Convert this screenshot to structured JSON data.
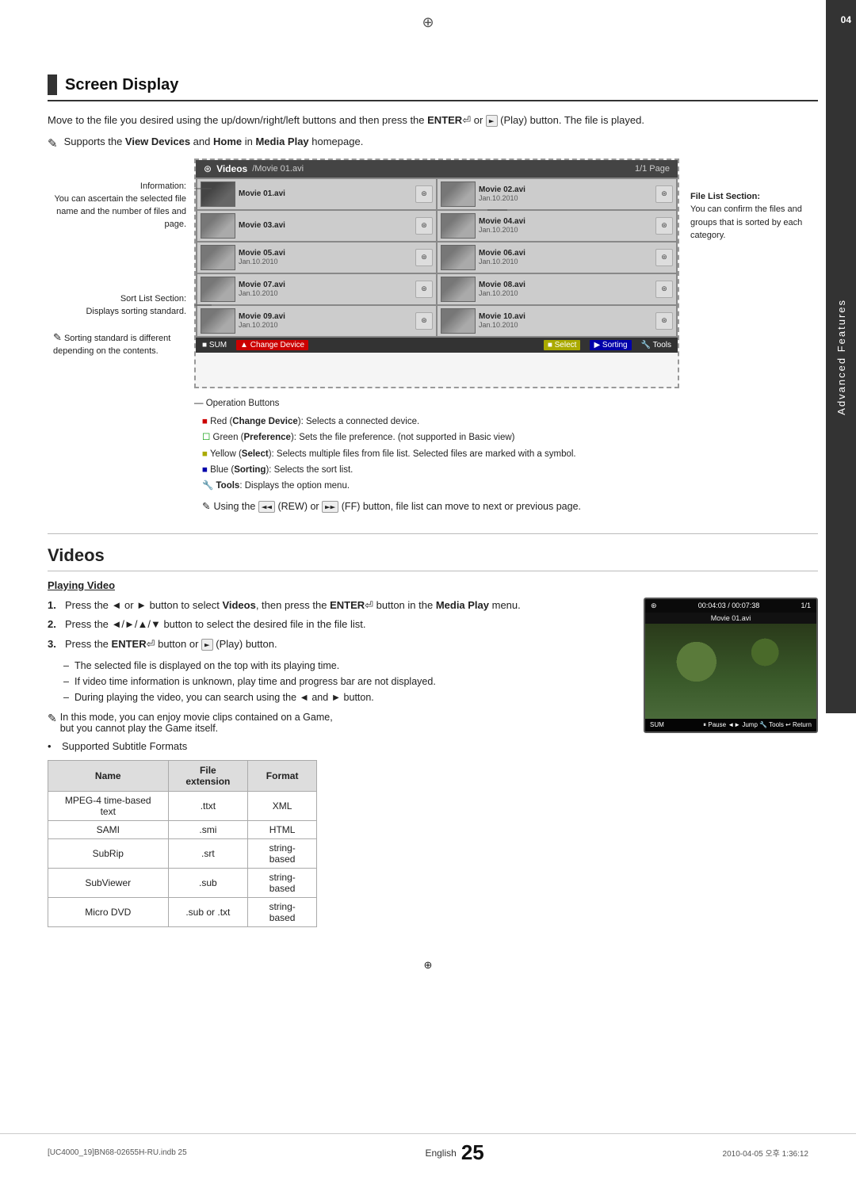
{
  "page": {
    "chapter_num": "04",
    "chapter_title": "Advanced Features",
    "page_number": "25",
    "page_lang": "English",
    "footer_left": "[UC4000_19]BN68-02655H-RU.indb  25",
    "footer_right": "2010-04-05  오후 1:36:12"
  },
  "screen_display": {
    "title": "Screen Display",
    "intro": "Move to the file you desired using the up/down/right/left buttons and then press the ENTER  or   (Play) button. The file is played.",
    "note": "Supports the View Devices and Home in Media Play homepage.",
    "diagram": {
      "header_icon": "⊛",
      "header_title": "Videos",
      "header_file": "/Movie 01.avi",
      "header_page": "1/1 Page",
      "videos": [
        {
          "name": "Movie 01.avi",
          "date": ""
        },
        {
          "name": "Movie 02.avi",
          "date": "Jan.10.2010"
        },
        {
          "name": "Movie 03.avi",
          "date": ""
        },
        {
          "name": "Movie 04.avi",
          "date": "Jan.10.2010"
        },
        {
          "name": "Movie 05.avi",
          "date": "Jan.10.2010"
        },
        {
          "name": "Movie 06.avi",
          "date": "Jan.10.2010"
        },
        {
          "name": "Movie 07.avi",
          "date": "Jan.10.2010"
        },
        {
          "name": "Movie 08.avi",
          "date": "Jan.10.2010"
        },
        {
          "name": "Movie 09.avi",
          "date": "Jan.10.2010"
        },
        {
          "name": "Movie 10.avi",
          "date": "Jan.10.2010"
        }
      ],
      "bottombar_buttons": [
        "SUM",
        "▲ Change Device",
        "■ Select",
        "▶ Sorting",
        "🔧 Tools"
      ]
    },
    "annotations": {
      "left_top": "Information:",
      "left_top_detail": "You can ascertain the selected file name and the number of files and page.",
      "left_bottom": "Sort List Section:",
      "left_bottom_detail": "Displays sorting standard.",
      "left_note": "Sorting standard is different depending on the contents.",
      "right_top": "File List Section:",
      "right_top_detail": "You can confirm the files and groups that is sorted by each category."
    },
    "operation_buttons": {
      "title": "Operation Buttons",
      "items": [
        "■ Red (Change Device): Selects a connected device.",
        "☐ Green (Preference): Sets the file preference. (not supported in Basic view)",
        "■ Yellow (Select): Selects multiple files from file list. Selected files are marked with a symbol.",
        "■ Blue (Sorting): Selects the sort list.",
        "🔧 Tools: Displays the option menu.",
        "Using the ◄◄ (REW) or ►► (FF) button, file list can move to next or previous page."
      ]
    }
  },
  "videos": {
    "title": "Videos",
    "subsection": "Playing Video",
    "steps": [
      "Press the ◄ or ► button to select Videos, then press the ENTER  button in the Media Play menu.",
      "Press the ◄/►/▲/▼ button to select the desired file in the file list.",
      "Press the ENTER  button or   (Play) button."
    ],
    "notes": [
      "The selected file is displayed on the top with its playing time.",
      "If video time information is unknown, play time and progress bar are not displayed.",
      "During playing the video, you can search using the ◄ and ► button."
    ],
    "mode_note": "In this mode, you can enjoy movie clips contained on a Game, but you cannot play the Game itself.",
    "subtitle_label": "Supported Subtitle Formats",
    "subtitle_table": {
      "headers": [
        "Name",
        "File extension",
        "Format"
      ],
      "rows": [
        [
          "MPEG-4 time-based text",
          ".ttxt",
          "XML"
        ],
        [
          "SAMI",
          ".smi",
          "HTML"
        ],
        [
          "SubRip",
          ".srt",
          "string-based"
        ],
        [
          "SubViewer",
          ".sub",
          "string-based"
        ],
        [
          "Micro DVD",
          ".sub or .txt",
          "string-based"
        ]
      ]
    },
    "player": {
      "time": "00:04:03 / 00:07:38",
      "page": "1/1",
      "filename": "Movie 01.avi",
      "sum_label": "SUM",
      "controls": "⏸ Pause  ◄► Jump  🔧 Tools  ↩ Return"
    }
  }
}
